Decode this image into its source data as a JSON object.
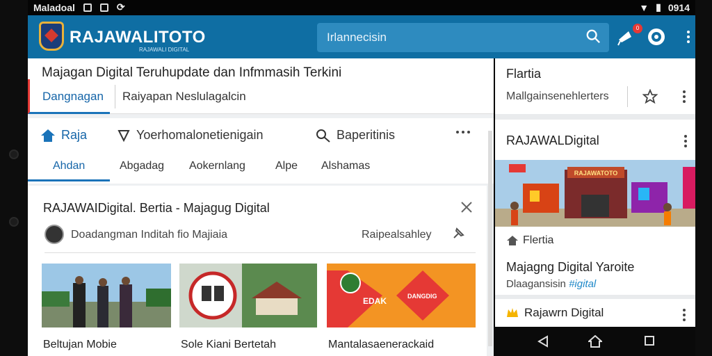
{
  "status": {
    "left_text": "Maladoal",
    "right_text": "0914"
  },
  "appbar": {
    "brand": "RAJAWALITOTO",
    "brand_sub": "RAJAWALI DIGITAL",
    "search_value": "Irlannecisin",
    "notif_count": "0"
  },
  "header": {
    "title": "Majagan Digital Teruhupdate dan Infmmasih Terkini",
    "tab_active": "Dangnagan",
    "tab_other": "Raiyapan Neslulagalcin"
  },
  "nav": {
    "items": [
      {
        "label": "Raja",
        "icon": "home-icon"
      },
      {
        "label": "Yoerhomalonetienigain",
        "icon": "pin-icon"
      },
      {
        "label": "Baperitinis",
        "icon": "search-icon"
      }
    ],
    "subtabs": [
      "Ahdan",
      "Abgadag",
      "Aokernlang",
      "Alpe",
      "Alshamas"
    ]
  },
  "card": {
    "title": "RAJAWAIDigital. Bertia - Majagug Digital",
    "meta": "Doadangman Inditah fio Majiaia",
    "meta_right": "Raipealsahley",
    "thumbs": [
      {
        "caption": "Beltujan Mobie"
      },
      {
        "caption": "Sole Kiani Bertetah"
      },
      {
        "caption": "Mantalasaenerackaid",
        "label": "EDAK",
        "label2": "DANGDIG"
      }
    ]
  },
  "side": {
    "header_title": "Flartia",
    "header_sub": "Mallgainsenehlerters",
    "card_title": "RAJAWALDigital",
    "sign": "RAJAWATOTO",
    "label": "Flertia",
    "headline": "Majagng Digital Yaroite",
    "sub_plain": "Dlaagansisin ",
    "sub_link": "#igital",
    "footer": "Rajawrn Digital"
  },
  "colors": {
    "appbar": "#0f6ea3",
    "accent": "#1a73b9",
    "alert": "#e53935"
  }
}
